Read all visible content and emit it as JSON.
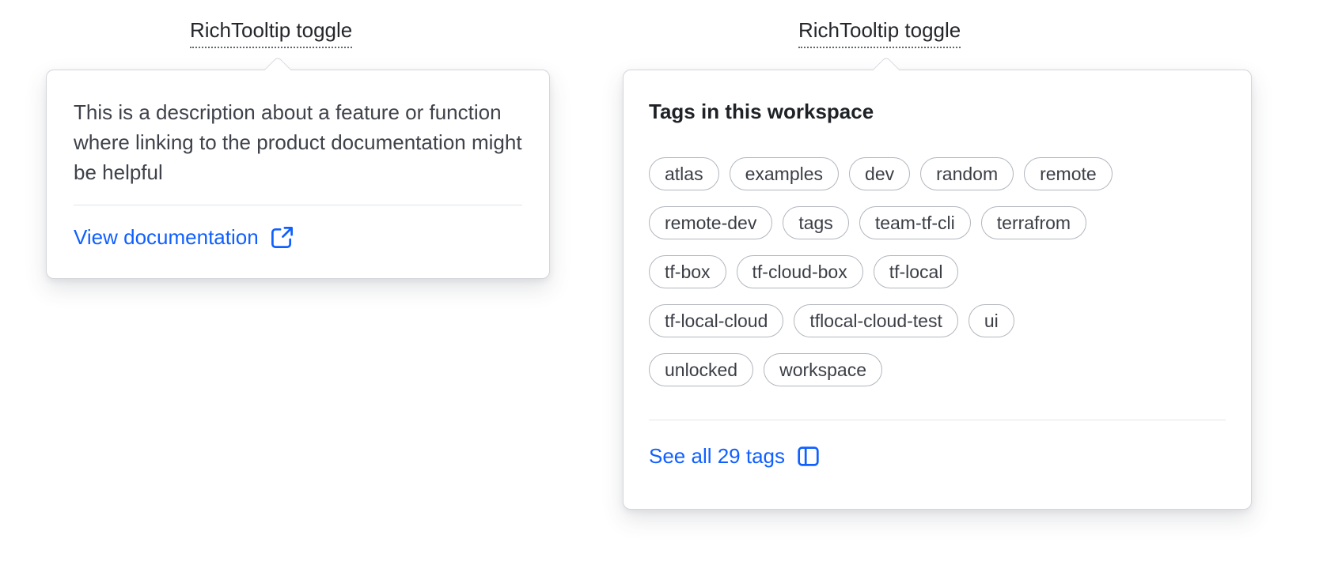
{
  "colors": {
    "link": "#1060ff",
    "text": "#3f424a",
    "heading": "#1e2126",
    "toggle_text": "#24262b",
    "card_border": "#d4d6dc",
    "tag_border": "#b2b6bd",
    "divider": "#e2e4e8"
  },
  "left_tooltip": {
    "toggle_label": "RichTooltip toggle",
    "description": "This is a description about a feature or function where linking to the product documentation might be helpful",
    "link_label": "View documentation",
    "link_icon": "external-link-icon"
  },
  "right_tooltip": {
    "toggle_label": "RichTooltip toggle",
    "title": "Tags in this workspace",
    "tag_rows": [
      [
        "atlas",
        "examples",
        "dev",
        "random",
        "remote"
      ],
      [
        "remote-dev",
        "tags",
        "team-tf-cli",
        "terrafrom"
      ],
      [
        "tf-box",
        "tf-cloud-box",
        "tf-local"
      ],
      [
        "tf-local-cloud",
        "tflocal-cloud-test",
        "ui"
      ],
      [
        "unlocked",
        "workspace"
      ]
    ],
    "link_label": "See all 29 tags",
    "link_icon": "sidebar-icon"
  }
}
